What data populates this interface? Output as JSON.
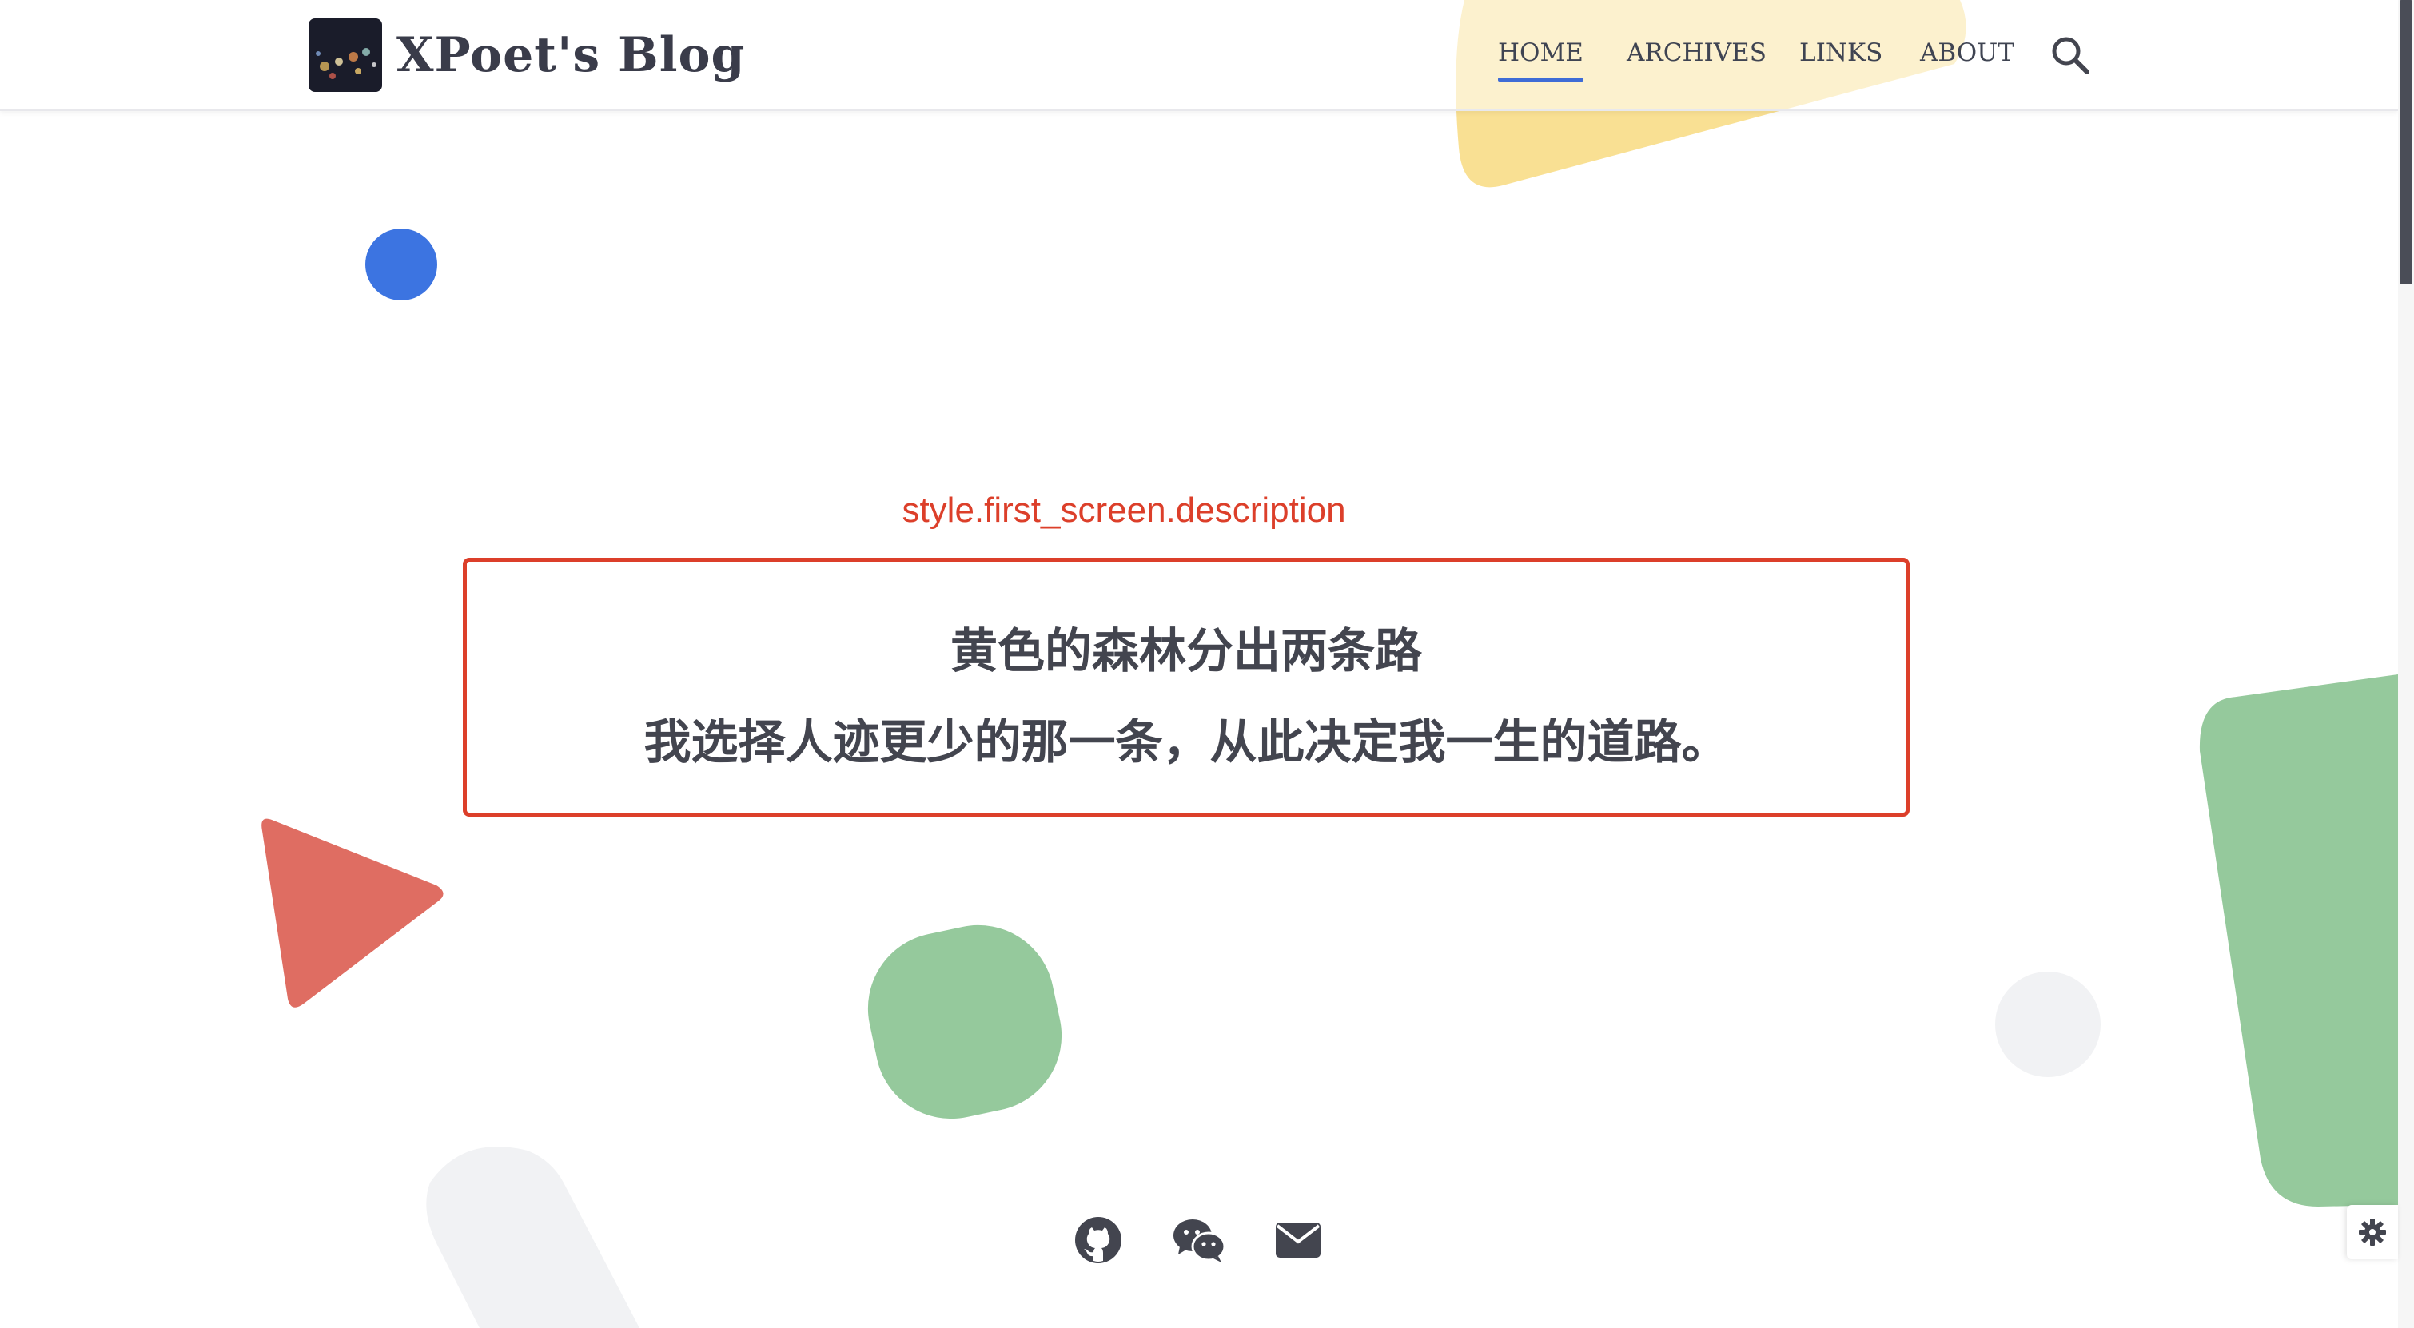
{
  "site": {
    "title": "XPoet's Blog"
  },
  "nav": {
    "items": [
      {
        "label": "HOME",
        "active": true
      },
      {
        "label": "ARCHIVES",
        "active": false
      },
      {
        "label": "LINKS",
        "active": false
      },
      {
        "label": "ABOUT",
        "active": false
      }
    ]
  },
  "first_screen": {
    "annotation_label": "style.first_screen.description",
    "description_lines": [
      "黄色的森林分出两条路",
      "我选择人迹更少的那一条，从此决定我一生的道路。"
    ]
  },
  "social": {
    "icons": [
      "github-icon",
      "wechat-icon",
      "email-icon"
    ]
  },
  "icons": {
    "search": "search-icon",
    "settings": "gear-icon"
  },
  "colors": {
    "accent_blue": "#3e6cd6",
    "annotation_red": "#dc3f2a",
    "shape_yellow": "#f7d774",
    "shape_green": "#95c99c",
    "shape_red": "#df6d62",
    "shape_gray": "#f1f2f4",
    "text_dark": "#43454f"
  }
}
